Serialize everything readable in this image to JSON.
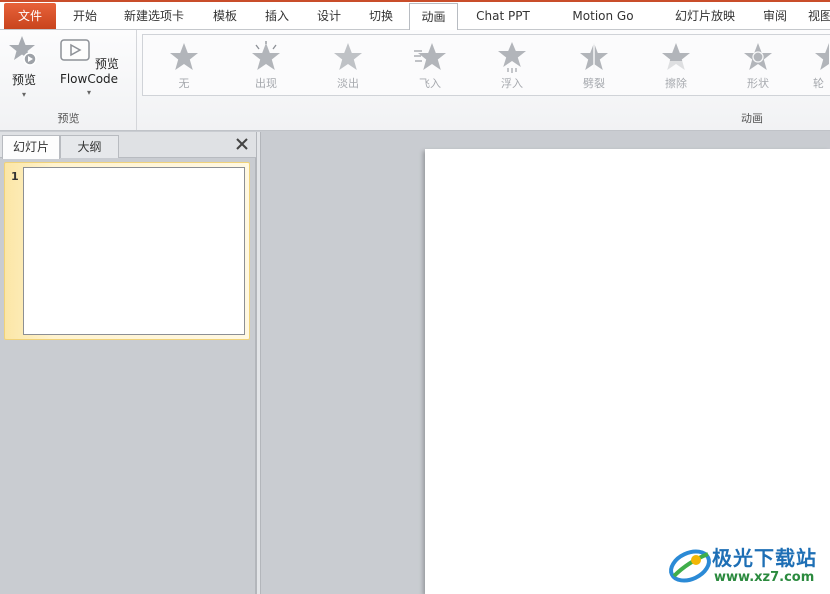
{
  "tabs": [
    {
      "label": "文件"
    },
    {
      "label": "开始"
    },
    {
      "label": "新建选项卡"
    },
    {
      "label": "模板"
    },
    {
      "label": "插入"
    },
    {
      "label": "设计"
    },
    {
      "label": "切换"
    },
    {
      "label": "动画"
    },
    {
      "label": "Chat PPT"
    },
    {
      "label": "Motion Go"
    },
    {
      "label": "幻灯片放映"
    },
    {
      "label": "审阅"
    },
    {
      "label": "视图"
    }
  ],
  "active_tab": "动画",
  "ribbon": {
    "preview_group": {
      "label": "预览",
      "preview_button": "预览",
      "flowcode_button": "预览FlowCode"
    },
    "animation_group": {
      "label": "动画",
      "items": [
        {
          "label": "无"
        },
        {
          "label": "出现"
        },
        {
          "label": "淡出"
        },
        {
          "label": "飞入"
        },
        {
          "label": "浮入"
        },
        {
          "label": "劈裂"
        },
        {
          "label": "擦除"
        },
        {
          "label": "形状"
        },
        {
          "label": "轮"
        }
      ]
    }
  },
  "slides_pane": {
    "tabs": [
      {
        "label": "幻灯片"
      },
      {
        "label": "大纲"
      }
    ],
    "slides": [
      {
        "number": "1"
      }
    ]
  },
  "watermark": {
    "text": "极光下载站",
    "url": "www.xz7.com"
  },
  "colors": {
    "file_tab": "#d54f28",
    "accent": "#c94d2a",
    "selection": "#fbe6a6",
    "workspace": "#c9ccd1"
  }
}
